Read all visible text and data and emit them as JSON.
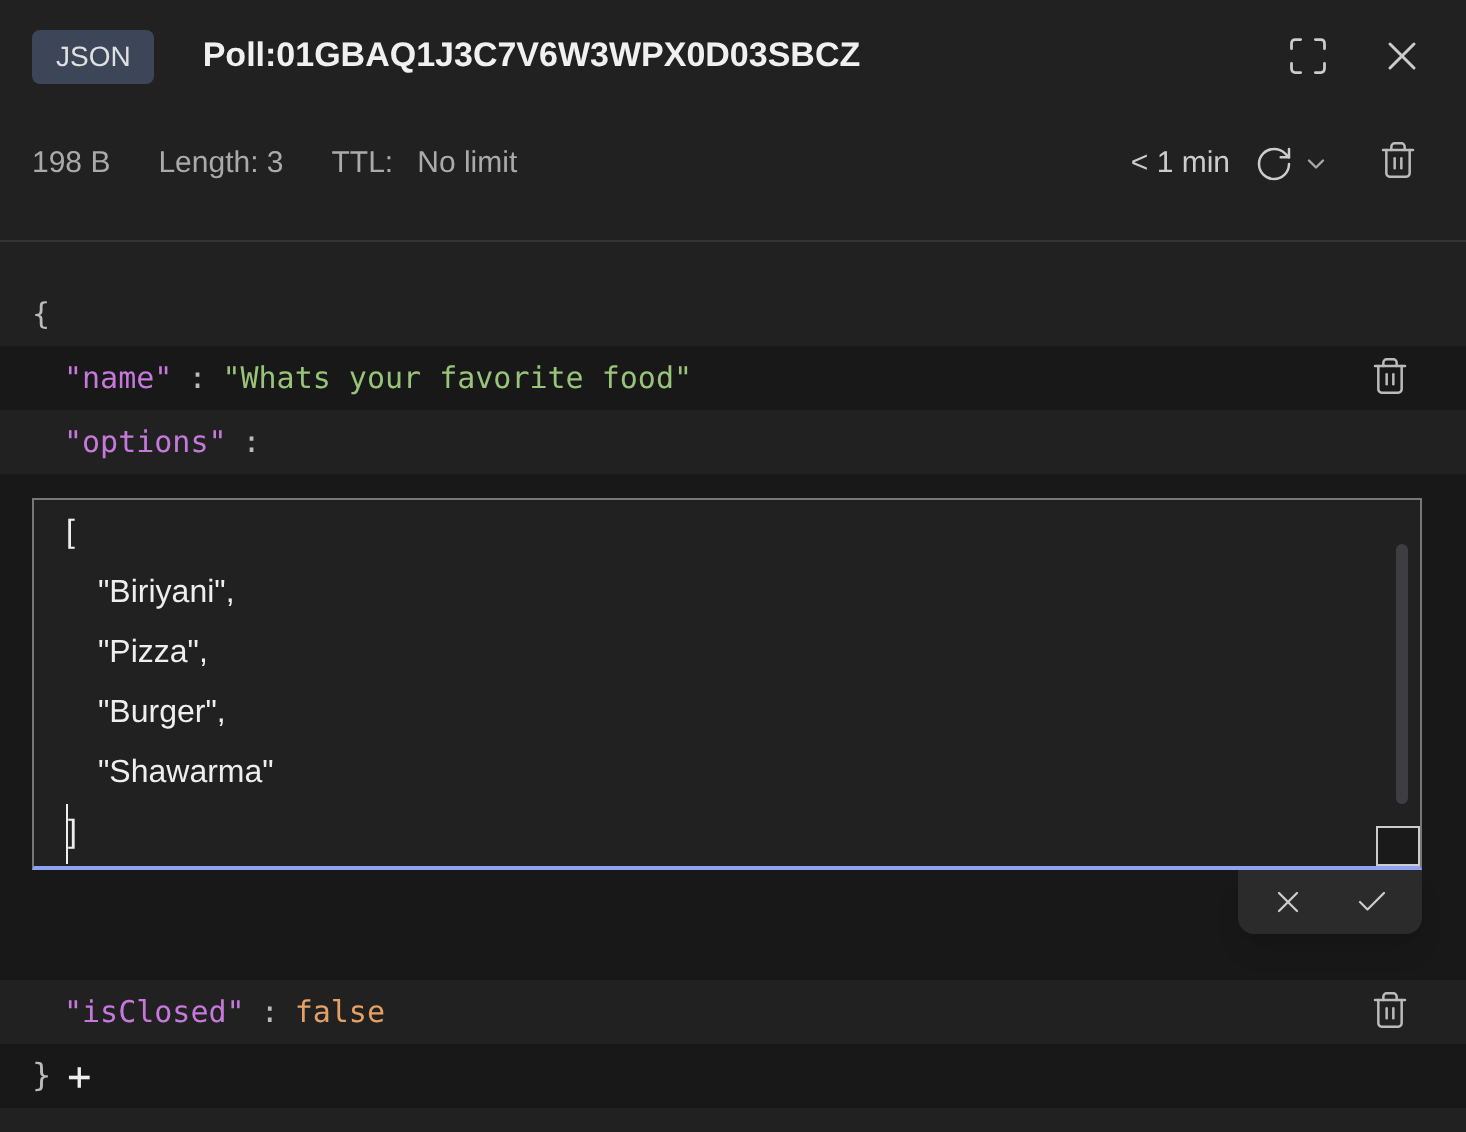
{
  "badge": "JSON",
  "key_name": "Poll:01GBAQ1J3C7V6W3WPX0D03SBCZ",
  "meta": {
    "size": "198 B",
    "length": "Length: 3",
    "ttl_label": "TTL:",
    "ttl_value": "No limit",
    "refresh": "< 1 min"
  },
  "open_brace": "{",
  "fields": [
    {
      "kind": "string",
      "key": "\"name\"",
      "colon": ":",
      "value": "\"Whats your favorite food\""
    },
    {
      "kind": "editor",
      "key": "\"options\"",
      "colon": ":",
      "open": "[",
      "items": [
        "\"Biriyani\",",
        "\"Pizza\",",
        "\"Burger\",",
        "\"Shawarma\""
      ],
      "close": "]"
    },
    {
      "kind": "boolean",
      "key": "\"isClosed\"",
      "colon": ":",
      "value": "false"
    }
  ],
  "close_brace": "}",
  "add": "+"
}
